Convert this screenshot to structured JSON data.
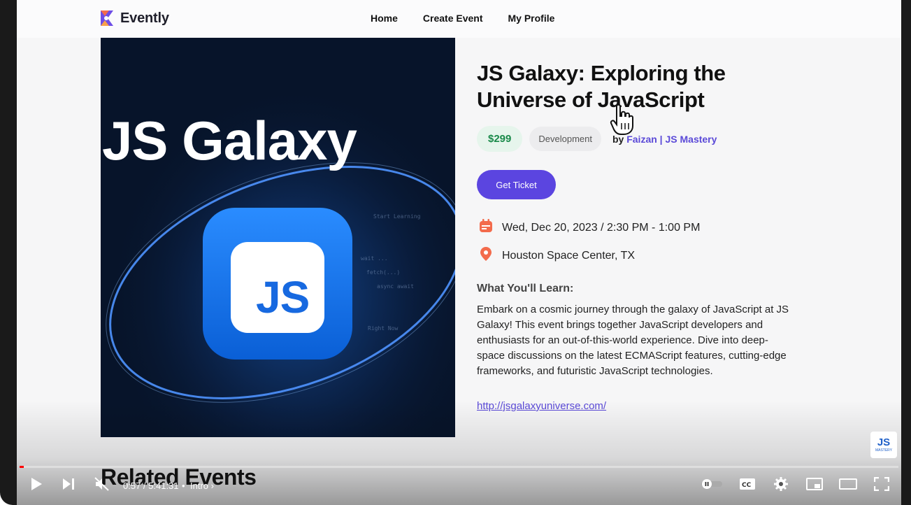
{
  "header": {
    "app_name": "Evently",
    "nav": [
      "Home",
      "Create Event",
      "My Profile"
    ]
  },
  "hero": {
    "image_title": "JS Galaxy",
    "badge_text": "JS"
  },
  "event": {
    "title": "JS Galaxy: Exploring the Universe of JavaScript",
    "price": "$299",
    "category": "Development",
    "by_label": "by",
    "organizer": "Faizan | JS Mastery",
    "ticket_button": "Get Ticket",
    "date_time": "Wed, Dec 20, 2023 / 2:30 PM - 1:00 PM",
    "location": "Houston Space Center, TX",
    "section_heading": "What You'll Learn:",
    "description": "Embark on a cosmic journey through the galaxy of JavaScript at JS Galaxy! This event brings together JavaScript developers and enthusiasts for an out-of-this-world experience. Dive into deep-space discussions on the latest ECMAScript features, cutting-edge frameworks, and futuristic JavaScript technologies.",
    "url": "http://jsgalaxyuniverse.com/"
  },
  "related": {
    "heading": "Related Events"
  },
  "watermark": {
    "logo_text": "JS",
    "sub_text": "MASTERY"
  },
  "player": {
    "time": "0:57 / 5:41:31",
    "separator": "•",
    "chapter": "Intro",
    "progress": 0.003,
    "colors": {
      "progress": "#ff0000",
      "accent": "#5b45e0",
      "price": "#1a8a4a"
    }
  }
}
